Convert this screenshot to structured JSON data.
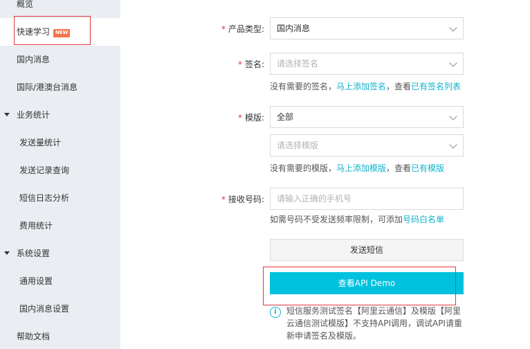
{
  "sidebar": {
    "items": [
      {
        "label": "概览"
      },
      {
        "label": "快速学习",
        "badge": "NEW"
      },
      {
        "label": "国内消息"
      },
      {
        "label": "国际/港澳台消息"
      },
      {
        "label": "业务统计"
      },
      {
        "label": "发送量统计"
      },
      {
        "label": "发送记录查询"
      },
      {
        "label": "短信日志分析"
      },
      {
        "label": "费用统计"
      },
      {
        "label": "系统设置"
      },
      {
        "label": "通用设置"
      },
      {
        "label": "国内消息设置"
      },
      {
        "label": "帮助文档"
      }
    ]
  },
  "form": {
    "product_type": {
      "label": "产品类型:",
      "value": "国内消息"
    },
    "signature": {
      "label": "签名:",
      "placeholder": "请选择签名",
      "hint_prefix": "没有需要的签名，",
      "hint_link1": "马上添加签名",
      "hint_mid": "，查看",
      "hint_link2": "已有签名列表"
    },
    "template": {
      "label": "模版:",
      "value": "全部",
      "placeholder": "请选择模版",
      "hint_prefix": "没有需要的模版，",
      "hint_link1": "马上添加模版",
      "hint_mid": "，查看",
      "hint_link2": "已有模版"
    },
    "phone": {
      "label": "接收号码:",
      "placeholder": "请输入正确的手机号",
      "hint_prefix": "如需号码不受发送频率限制，可添加",
      "hint_link": "号码白名单"
    },
    "required_mark": "*",
    "send_button": "发送短信",
    "demo_button": "查看API Demo",
    "note_icon": "i",
    "note": "短信服务测试签名【阿里云通信】及模版【阿里云通信测试模版】不支持API调用，调试API请重新申请签名及模版。"
  },
  "colors": {
    "accent": "#00c1de",
    "link": "#0fb2cc",
    "required": "#e0353a",
    "badge": "#f7734a",
    "sidebar_bg": "#eaedf1"
  }
}
